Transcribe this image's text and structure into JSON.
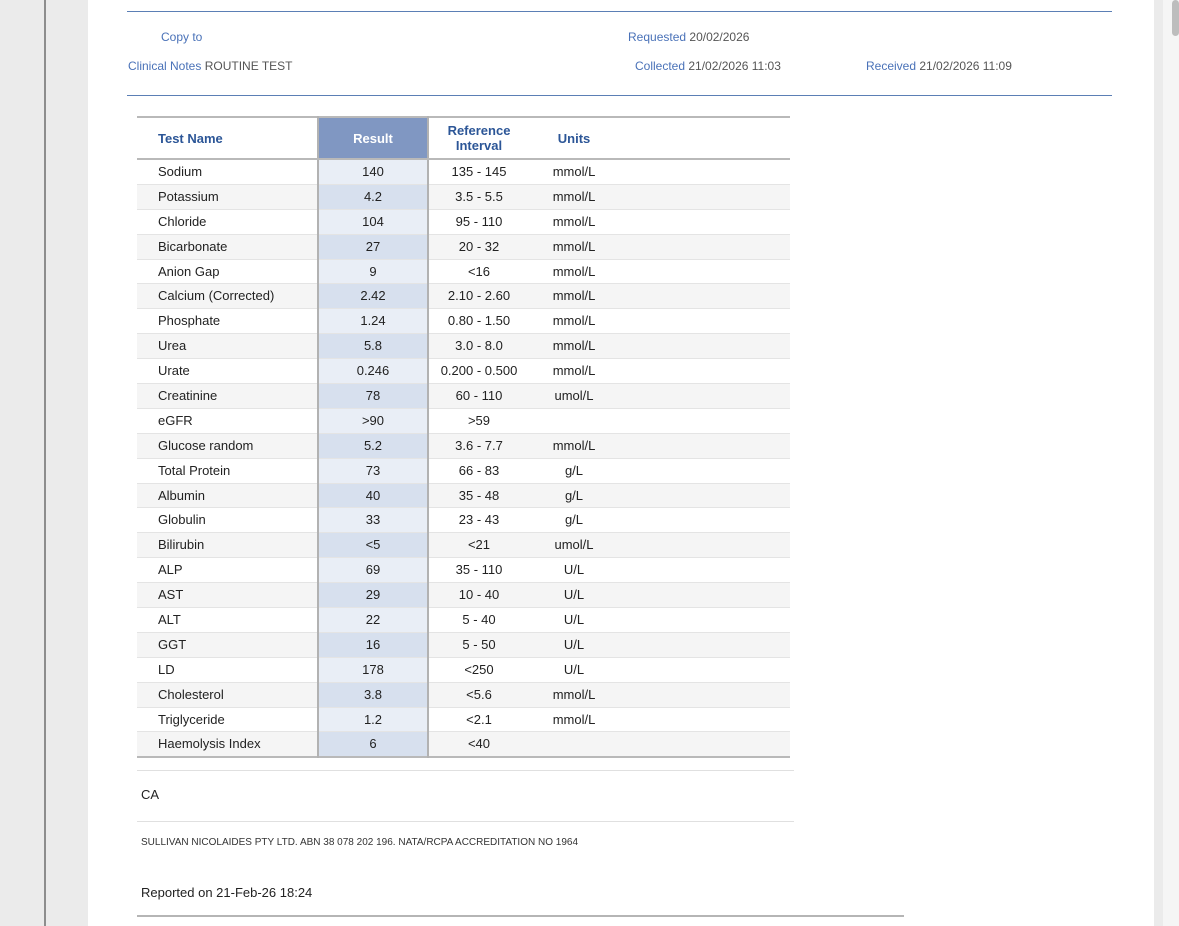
{
  "header": {
    "copy_to_label": "Copy to",
    "copy_to_value": "",
    "clinical_notes_label": "Clinical Notes",
    "clinical_notes_value": "ROUTINE TEST",
    "requested_label": "Requested",
    "requested_value": "20/02/2026",
    "collected_label": "Collected",
    "collected_value": "21/02/2026 11:03",
    "received_label": "Received",
    "received_value": "21/02/2026 11:09"
  },
  "table": {
    "columns": {
      "name": "Test Name",
      "result": "Result",
      "ref_line1": "Reference",
      "ref_line2": "Interval",
      "units": "Units"
    },
    "rows": [
      {
        "name": "Sodium",
        "result": "140",
        "ref": "135 - 145",
        "units": "mmol/L"
      },
      {
        "name": "Potassium",
        "result": "4.2",
        "ref": "3.5 - 5.5",
        "units": "mmol/L"
      },
      {
        "name": "Chloride",
        "result": "104",
        "ref": "95 - 110",
        "units": "mmol/L"
      },
      {
        "name": "Bicarbonate",
        "result": "27",
        "ref": "20 - 32",
        "units": "mmol/L"
      },
      {
        "name": "Anion Gap",
        "result": "9",
        "ref": "<16",
        "units": "mmol/L"
      },
      {
        "name": "Calcium (Corrected)",
        "result": "2.42",
        "ref": "2.10 - 2.60",
        "units": "mmol/L"
      },
      {
        "name": "Phosphate",
        "result": "1.24",
        "ref": "0.80 - 1.50",
        "units": "mmol/L"
      },
      {
        "name": "Urea",
        "result": "5.8",
        "ref": "3.0 - 8.0",
        "units": "mmol/L"
      },
      {
        "name": "Urate",
        "result": "0.246",
        "ref": "0.200 - 0.500",
        "units": "mmol/L"
      },
      {
        "name": "Creatinine",
        "result": "78",
        "ref": "60 - 110",
        "units": "umol/L"
      },
      {
        "name": "eGFR",
        "result": ">90",
        "ref": ">59",
        "units": ""
      },
      {
        "name": "Glucose random",
        "result": "5.2",
        "ref": "3.6 - 7.7",
        "units": "mmol/L"
      },
      {
        "name": "Total Protein",
        "result": "73",
        "ref": "66 - 83",
        "units": "g/L"
      },
      {
        "name": "Albumin",
        "result": "40",
        "ref": "35 - 48",
        "units": "g/L"
      },
      {
        "name": "Globulin",
        "result": "33",
        "ref": "23 - 43",
        "units": "g/L"
      },
      {
        "name": "Bilirubin",
        "result": "<5",
        "ref": "<21",
        "units": "umol/L"
      },
      {
        "name": "ALP",
        "result": "69",
        "ref": "35 - 110",
        "units": "U/L"
      },
      {
        "name": "AST",
        "result": "29",
        "ref": "10 - 40",
        "units": "U/L"
      },
      {
        "name": "ALT",
        "result": "22",
        "ref": "5 - 40",
        "units": "U/L"
      },
      {
        "name": "GGT",
        "result": "16",
        "ref": "5 - 50",
        "units": "U/L"
      },
      {
        "name": "LD",
        "result": "178",
        "ref": "<250",
        "units": "U/L"
      },
      {
        "name": "Cholesterol",
        "result": "3.8",
        "ref": "<5.6",
        "units": "mmol/L"
      },
      {
        "name": "Triglyceride",
        "result": "1.2",
        "ref": "<2.1",
        "units": "mmol/L"
      },
      {
        "name": "Haemolysis Index",
        "result": "6",
        "ref": "<40",
        "units": ""
      }
    ]
  },
  "footer": {
    "note": "CA",
    "lab_statement": "SULLIVAN NICOLAIDES PTY LTD. ABN 38 078 202 196. NATA/RCPA ACCREDITATION NO 1964",
    "reported": "Reported on 21-Feb-26 18:24"
  }
}
